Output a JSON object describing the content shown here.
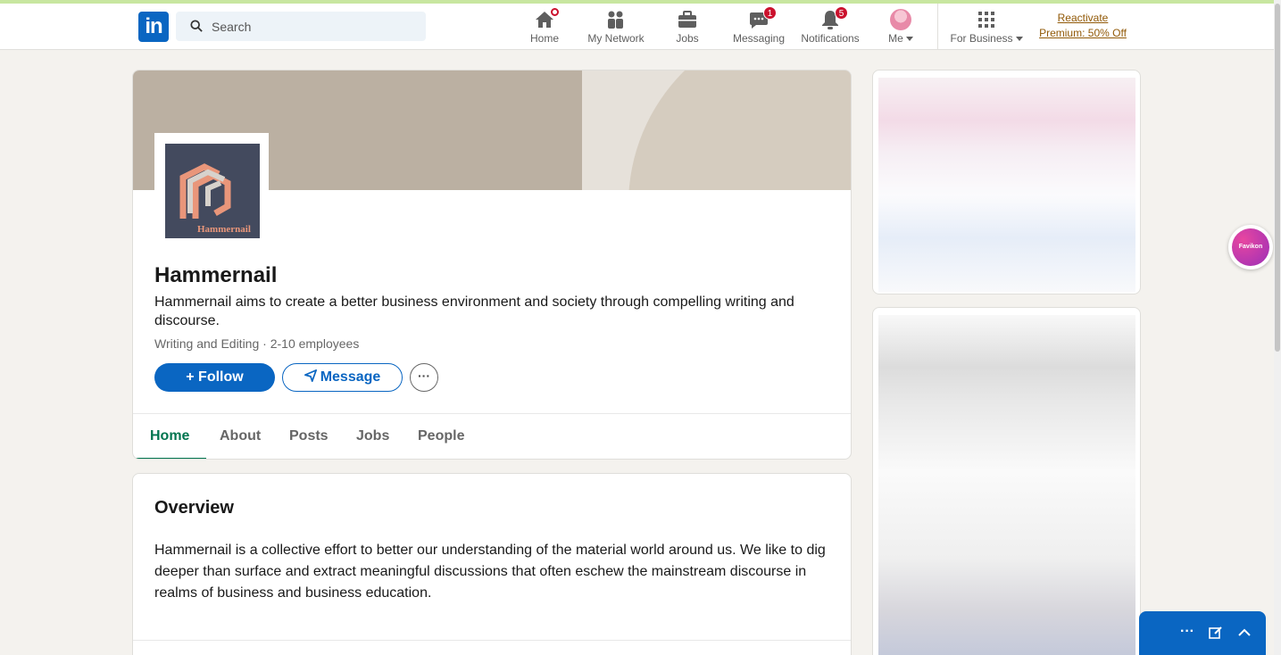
{
  "nav": {
    "search_placeholder": "Search",
    "home": "Home",
    "network": "My Network",
    "jobs": "Jobs",
    "messaging": "Messaging",
    "messaging_badge": "1",
    "notifications": "Notifications",
    "notifications_badge": "5",
    "me": "Me",
    "for_business": "For Business",
    "premium_line1": "Reactivate",
    "premium_line2": "Premium: 50% Off",
    "logo_text": "in"
  },
  "company": {
    "logo_wordmark": "Hammernail",
    "name": "Hammernail",
    "tagline": "Hammernail aims to create a better business environment and society through compelling writing and discourse.",
    "industry": "Writing and Editing",
    "separator": " · ",
    "size": "2-10 employees",
    "follow_label": "+ Follow",
    "message_label": "Message",
    "more_label": "···"
  },
  "tabs": [
    "Home",
    "About",
    "Posts",
    "Jobs",
    "People"
  ],
  "overview": {
    "title": "Overview",
    "text": "Hammernail is a collective effort to better our understanding of the material world around us. We like to dig deeper than surface and extract meaningful discussions that often eschew the mainstream discourse in realms of business and business education."
  },
  "favikon_label": "Favikon",
  "colors": {
    "brand_blue": "#0a66c2",
    "active_tab": "#01754f",
    "badge_red": "#cb112d",
    "premium_gold": "#915907"
  }
}
